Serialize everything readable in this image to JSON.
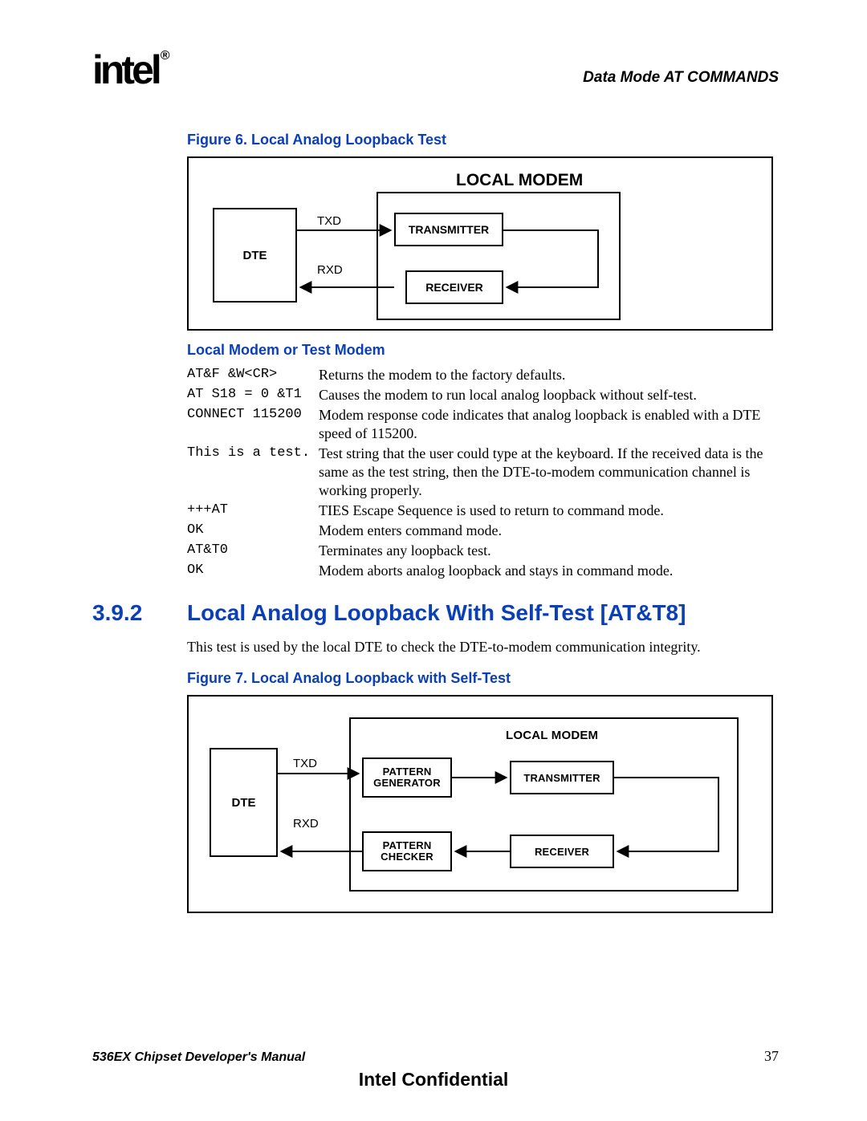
{
  "header": {
    "logo": "intel",
    "reg": "®",
    "title": "Data Mode AT COMMANDS"
  },
  "figure6": {
    "caption": "Figure 6.  Local Analog Loopback Test",
    "dte": "DTE",
    "txd": "TXD",
    "rxd": "RXD",
    "local_modem": "LOCAL MODEM",
    "transmitter": "TRANSMITTER",
    "receiver": "RECEIVER"
  },
  "local_modem_sub": "Local Modem or Test Modem",
  "cmds": [
    {
      "code": "AT&F &W<CR>",
      "desc": "Returns the modem to the factory defaults."
    },
    {
      "code": "AT S18 = 0 &T1",
      "desc": "Causes the modem to run local analog loopback without self-test."
    },
    {
      "code": "CONNECT 115200",
      "desc": "Modem response code indicates that analog loopback is enabled with a DTE speed of 115200."
    },
    {
      "code": "This is a test.",
      "desc": "Test string that the user could type at the keyboard. If the received data is the same as the test string, then the DTE-to-modem communication channel is working properly."
    },
    {
      "code": "+++AT",
      "desc": "TIES Escape Sequence is used to return to command mode."
    },
    {
      "code": "OK",
      "desc": "Modem enters command mode."
    },
    {
      "code": "AT&T0",
      "desc": "Terminates any loopback test."
    },
    {
      "code": "OK",
      "desc": "Modem aborts analog loopback and stays in command mode."
    }
  ],
  "section": {
    "num": "3.9.2",
    "title": "Local Analog Loopback With Self-Test [AT&T8]",
    "para": "This test is used by the local DTE to check the DTE-to-modem communication integrity."
  },
  "figure7": {
    "caption": "Figure 7.  Local Analog Loopback with Self-Test",
    "dte": "DTE",
    "txd": "TXD",
    "rxd": "RXD",
    "local_modem": "LOCAL MODEM",
    "pattern_generator": "PATTERN GENERATOR",
    "pattern_checker": "PATTERN CHECKER",
    "transmitter": "TRANSMITTER",
    "receiver": "RECEIVER"
  },
  "footer": {
    "left": "536EX Chipset Developer's Manual",
    "right": "37",
    "center": "Intel Confidential"
  }
}
